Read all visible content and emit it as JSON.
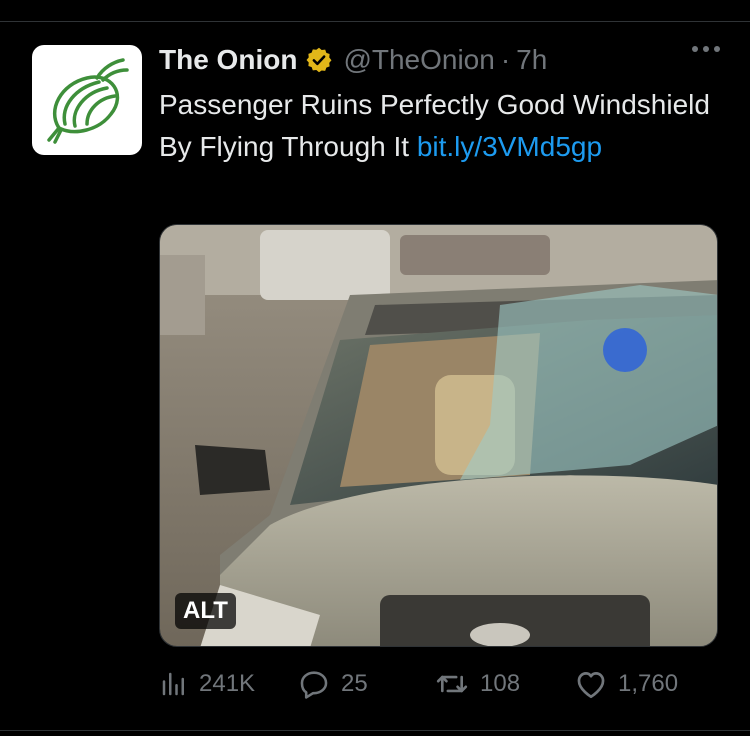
{
  "tweet": {
    "author_name": "The Onion",
    "handle": "@TheOnion",
    "separator": "·",
    "time": "7h",
    "text_main": "Passenger Ruins Perfectly Good Windshield By Flying Through It ",
    "link": "bit.ly/3VMd5gp"
  },
  "media": {
    "alt_label": "ALT"
  },
  "actions": {
    "views": "241K",
    "replies": "25",
    "retweets": "108",
    "likes": "1,760"
  },
  "icons": {
    "verified": "verified-badge-icon",
    "more": "more-options-icon",
    "views": "views-icon",
    "reply": "reply-icon",
    "retweet": "retweet-icon",
    "like": "heart-icon"
  },
  "colors": {
    "background": "#000000",
    "text": "#e7e9ea",
    "muted": "#71767b",
    "link": "#1d9bf0",
    "verified": "#e2b719",
    "onion_green": "#3e8f3a"
  }
}
